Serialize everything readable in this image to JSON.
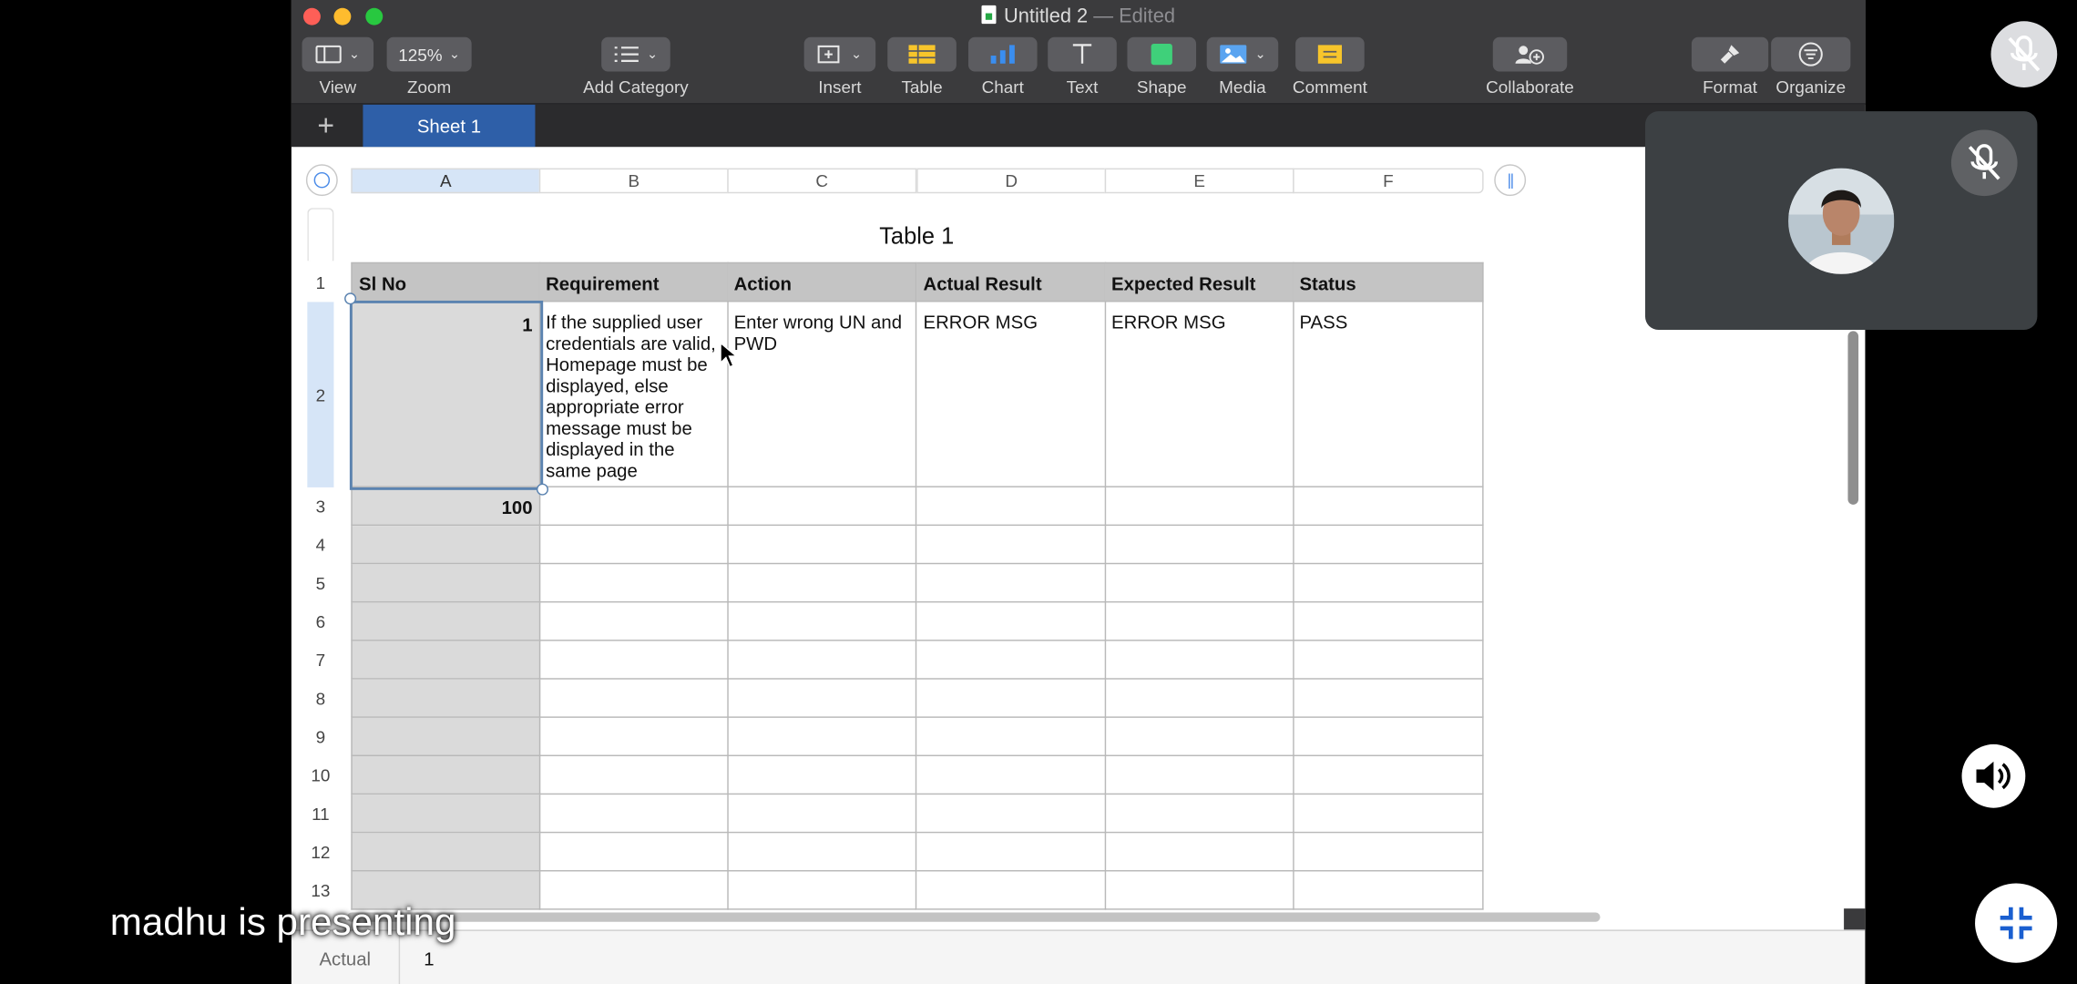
{
  "window": {
    "title": "Untitled 2",
    "status": "— Edited"
  },
  "toolbar": {
    "view_label": "View",
    "zoom_value": "125%",
    "zoom_label": "Zoom",
    "add_category_label": "Add Category",
    "insert_label": "Insert",
    "table_label": "Table",
    "chart_label": "Chart",
    "text_label": "Text",
    "shape_label": "Shape",
    "media_label": "Media",
    "comment_label": "Comment",
    "collaborate_label": "Collaborate",
    "format_label": "Format",
    "organize_label": "Organize"
  },
  "tabs": {
    "add_symbol": "+",
    "sheet": "Sheet 1"
  },
  "columns": [
    "A",
    "B",
    "C",
    "D",
    "E",
    "F"
  ],
  "rows": [
    "1",
    "2",
    "3",
    "4",
    "5",
    "6",
    "7",
    "8",
    "9",
    "10",
    "11",
    "12",
    "13"
  ],
  "table": {
    "title": "Table 1",
    "headers": [
      "Sl No",
      "Requirement",
      "Action",
      "Actual Result",
      "Expected Result",
      "Status"
    ],
    "row2": [
      "1",
      "If the supplied user credentials are valid, Homepage must be displayed, else appropriate error message must be displayed in the same page",
      "Enter wrong UN and PWD",
      "ERROR MSG",
      "ERROR MSG",
      "PASS"
    ],
    "row3_first": "100"
  },
  "bottom_bar": {
    "name": "Actual",
    "value": "1"
  },
  "overlay": {
    "presenting_text": "madhu is presenting"
  },
  "colors": {
    "accent": "#2e5fa8",
    "toolbar_bg": "#3b3b3d",
    "header_fill": "#c4c4c4",
    "first_column_fill": "#dadada",
    "selection_blue": "#d6e5f7"
  }
}
